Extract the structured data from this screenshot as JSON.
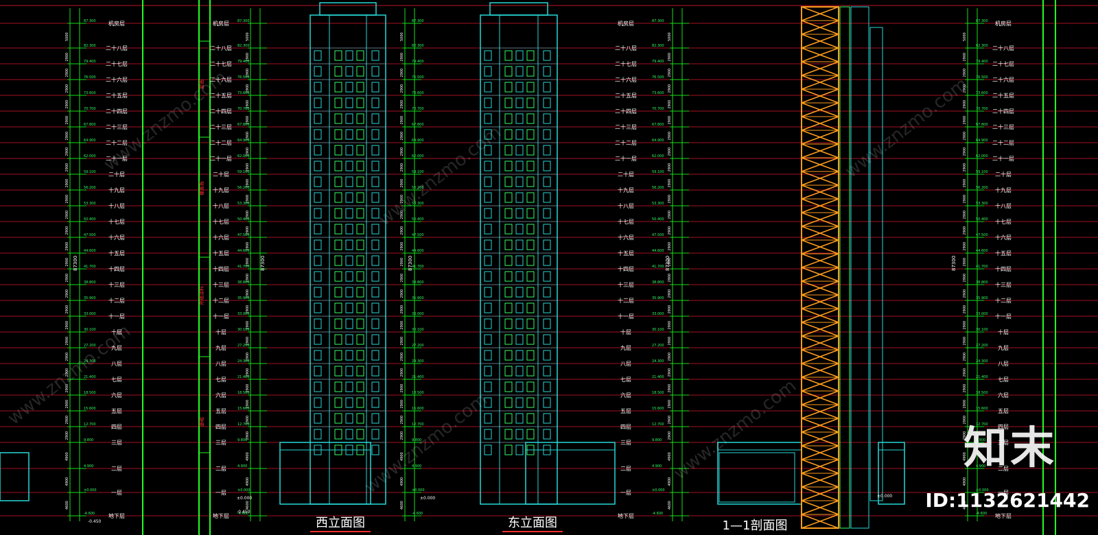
{
  "drawing": {
    "titles": {
      "west_elevation": "西立面图",
      "east_elevation": "东立面图",
      "section": "1—1剖面图"
    },
    "side_labels": [
      "屋面",
      "覆盖板",
      "外墙涂料",
      "基础"
    ],
    "floor_labels": [
      "机房层",
      "二十八层",
      "二十七层",
      "二十六层",
      "二十五层",
      "二十四层",
      "二十三层",
      "二十二层",
      "二十一层",
      "二十层",
      "十九层",
      "十八层",
      "十七层",
      "十六层",
      "十五层",
      "十四层",
      "十三层",
      "十二层",
      "十一层",
      "十层",
      "九层",
      "八层",
      "七层",
      "六层",
      "五层",
      "四层",
      "三层",
      "二层",
      "一层",
      "地下层"
    ],
    "elevations": [
      "87.300",
      "82.300",
      "79.400",
      "76.500",
      "73.600",
      "70.700",
      "67.800",
      "64.900",
      "62.000",
      "59.100",
      "56.200",
      "53.300",
      "50.400",
      "47.500",
      "44.600",
      "41.700",
      "38.800",
      "35.900",
      "33.000",
      "30.100",
      "27.200",
      "24.300",
      "21.400",
      "18.500",
      "15.600",
      "12.700",
      "9.800",
      "4.900",
      "±0.000",
      "-4.600"
    ],
    "dims": [
      "5000",
      "2900",
      "2900",
      "2900",
      "2900",
      "2900",
      "2900",
      "2900",
      "2900",
      "2900",
      "2900",
      "2900",
      "2900",
      "2900",
      "2900",
      "2900",
      "2900",
      "2900",
      "2900",
      "2900",
      "2900",
      "2900",
      "2900",
      "2900",
      "2900",
      "2900",
      "4900",
      "4900",
      "4600"
    ],
    "total_height": "87300",
    "ground_label": "±0.000",
    "base_label": "-0.450"
  },
  "watermark": {
    "text": "www.znzmo.com"
  },
  "brand": {
    "logo": "知末",
    "id": "ID:1132621442"
  },
  "colors": {
    "background": "#000000",
    "floor_line": "#c0132a",
    "dim_line": "#18e018",
    "frame": "#22ff22",
    "facade": "#28d8d8",
    "window": "#33ff66",
    "brace": "#ff9d1c",
    "text": "#ffffff",
    "title_underline": "#ff3030"
  }
}
